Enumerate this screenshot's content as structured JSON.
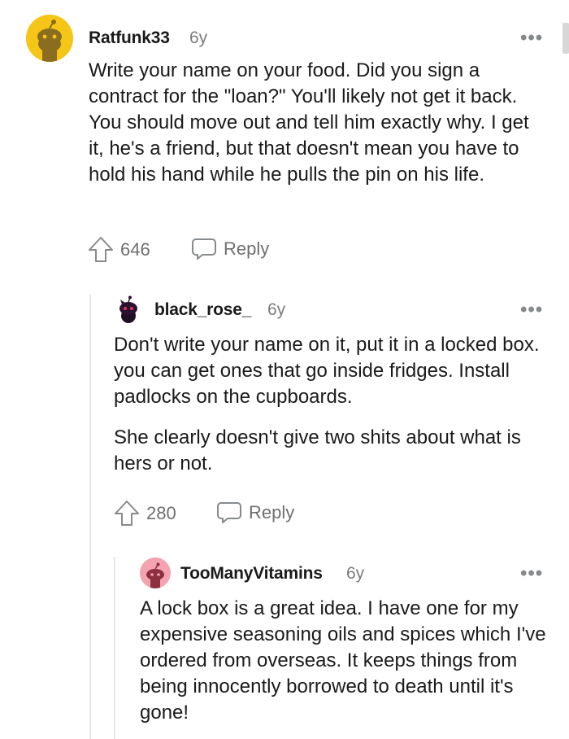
{
  "comments": [
    {
      "username": "Ratfunk33",
      "age": "6y",
      "paragraphs": [
        "Write your name on your food. Did you sign a contract for the \"loan?\" You'll likely not get it back. You should move out and tell him exactly why. I get it, he's a friend, but that doesn't mean you have to hold his hand while he pulls the pin on his life."
      ],
      "upvotes": "646",
      "reply_label": "Reply",
      "avatar_color": "#f5c518"
    },
    {
      "username": "black_rose_",
      "age": "6y",
      "paragraphs": [
        "Don't write your name on it, put it in a locked box. you can get ones that go inside fridges. Install padlocks on the cupboards.",
        "She clearly doesn't give two shits about what is hers or not."
      ],
      "upvotes": "280",
      "reply_label": "Reply",
      "avatar_color": "#1a1a1b"
    },
    {
      "username": "TooManyVitamins",
      "age": "6y",
      "paragraphs": [
        "A lock box is a great idea. I have one for my expensive seasoning oils and spices which I've ordered from overseas. It keeps things from being innocently borrowed to death until it's gone!"
      ],
      "avatar_color": "#f4a3b0"
    }
  ],
  "more_glyph": "•••"
}
